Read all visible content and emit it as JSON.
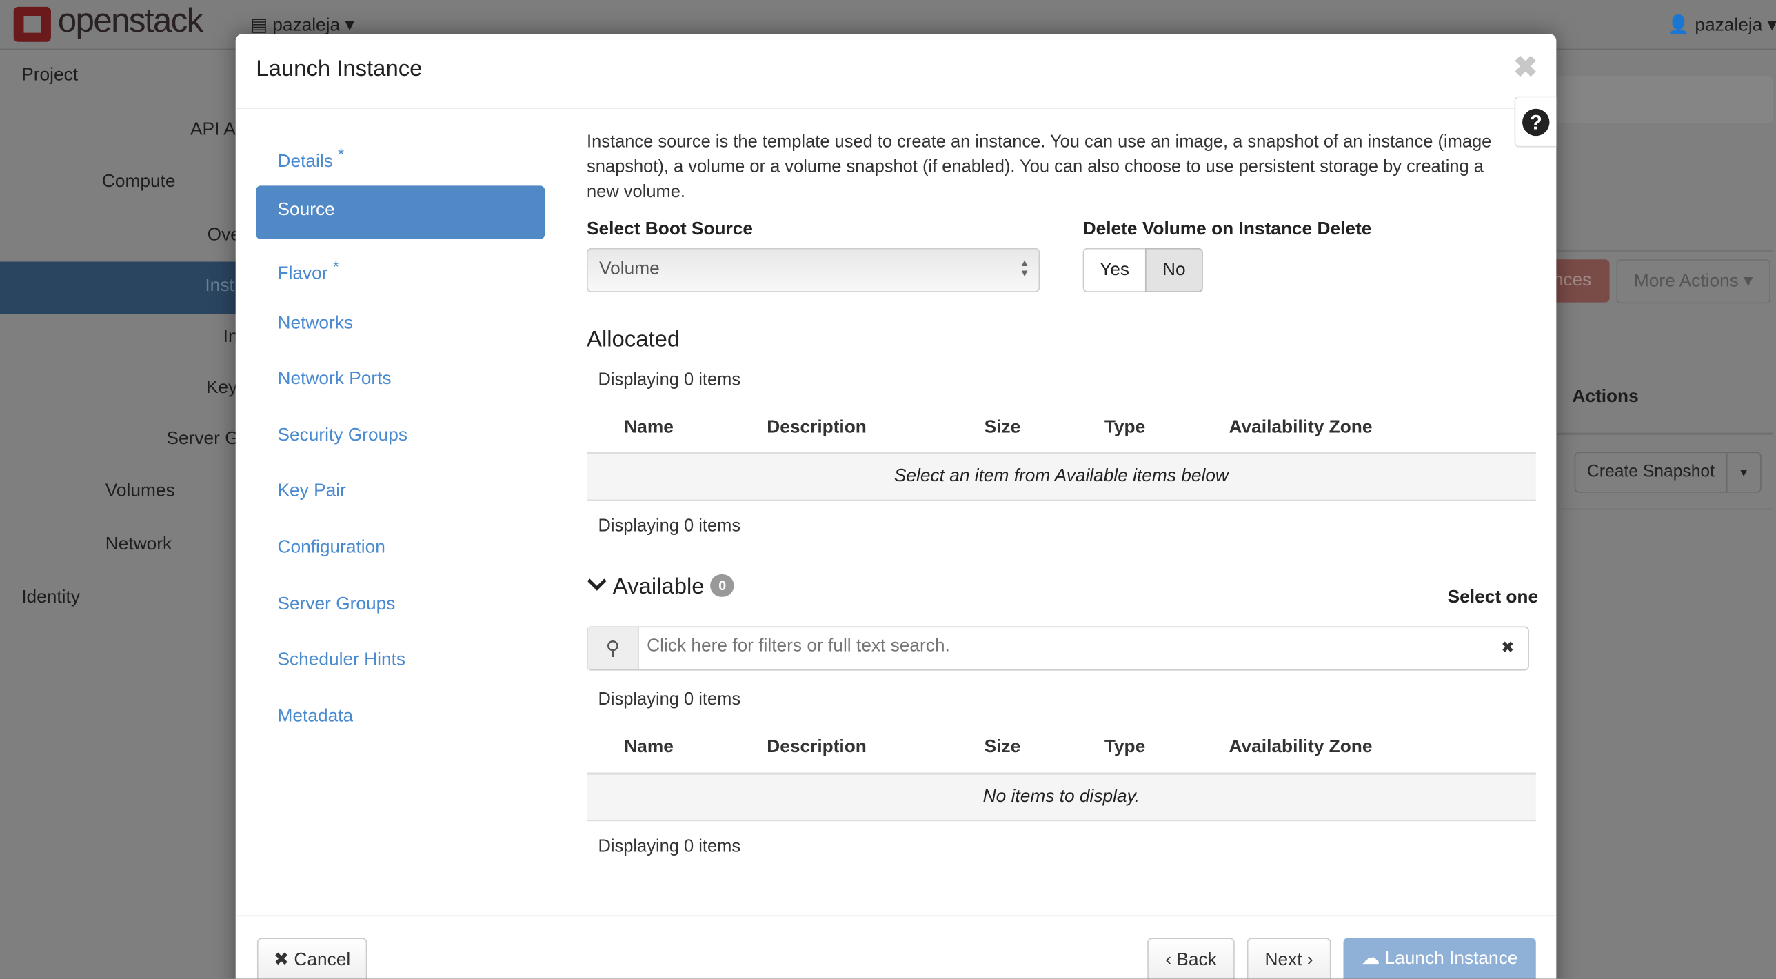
{
  "topbar": {
    "brand": "openstack",
    "project": "pazaleja",
    "user": "pazaleja"
  },
  "sidebar": {
    "items": [
      "Project",
      "API A",
      "Compute",
      "Ove",
      "Inst",
      "In",
      "Key",
      "Server G",
      "Volumes",
      "Network",
      "Identity"
    ]
  },
  "background": {
    "launch_partial": "nces",
    "more_actions": "More Actions",
    "actions_header": "Actions",
    "create_snapshot": "Create Snapshot"
  },
  "modal": {
    "title": "Launch Instance",
    "nav": [
      {
        "label": "Details",
        "required": "*"
      },
      {
        "label": "Source"
      },
      {
        "label": "Flavor",
        "required": "*"
      },
      {
        "label": "Networks"
      },
      {
        "label": "Network Ports"
      },
      {
        "label": "Security Groups"
      },
      {
        "label": "Key Pair"
      },
      {
        "label": "Configuration"
      },
      {
        "label": "Server Groups"
      },
      {
        "label": "Scheduler Hints"
      },
      {
        "label": "Metadata"
      }
    ],
    "intro": "Instance source is the template used to create an instance. You can use an image, a snapshot of an instance (image snapshot), a volume or a volume snapshot (if enabled). You can also choose to use persistent storage by creating a new volume.",
    "boot_source_label": "Select Boot Source",
    "boot_source_value": "Volume",
    "delete_label": "Delete Volume on Instance Delete",
    "yes": "Yes",
    "no": "No",
    "delete_selected": "No",
    "allocated": {
      "title": "Allocated",
      "count_text": "Displaying 0 items",
      "columns": [
        "Name",
        "Description",
        "Size",
        "Type",
        "Availability Zone"
      ],
      "empty": "Select an item from Available items below"
    },
    "available": {
      "title": "Available",
      "badge": "0",
      "select_hint": "Select one",
      "search_placeholder": "Click here for filters or full text search.",
      "count_text": "Displaying 0 items",
      "columns": [
        "Name",
        "Description",
        "Size",
        "Type",
        "Availability Zone"
      ],
      "empty": "No items to display."
    },
    "footer": {
      "cancel": "Cancel",
      "back": "Back",
      "next": "Next",
      "launch": "Launch Instance"
    },
    "colors": {
      "accent": "#5089c6",
      "launch_disabled": "#8fb1d8"
    }
  }
}
